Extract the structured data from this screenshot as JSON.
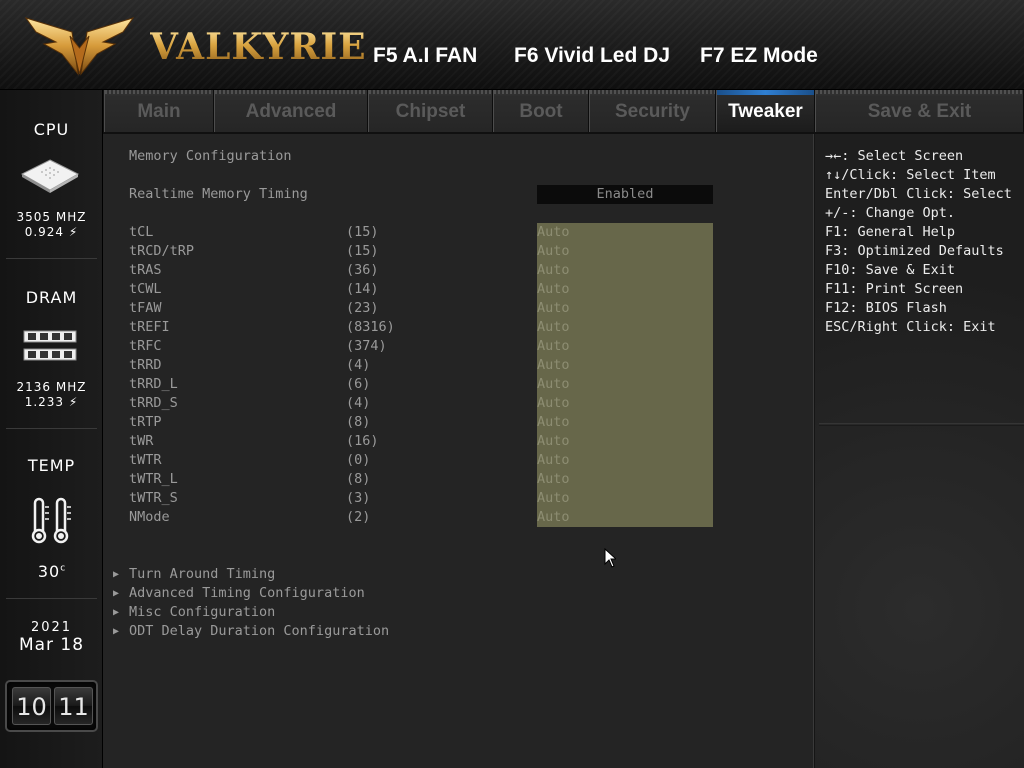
{
  "header": {
    "brand": "VALKYRIE",
    "hotkeys": [
      {
        "label": "F5 A.I FAN"
      },
      {
        "label": "F6 Vivid Led DJ"
      },
      {
        "label": "F7 EZ Mode"
      }
    ]
  },
  "sidebar": {
    "cpu": {
      "title": "CPU",
      "freq": "3505 MHZ",
      "volt": "0.924",
      "icon": "cpu-chip-icon"
    },
    "dram": {
      "title": "DRAM",
      "freq": "2136 MHZ",
      "volt": "1.233",
      "icon": "ram-module-icon"
    },
    "temp": {
      "title": "TEMP",
      "value": "30",
      "unit": "c",
      "icon": "thermometer-icon"
    },
    "date": {
      "year": "2021",
      "month_day": "Mar 18"
    },
    "clock": {
      "hour": "10",
      "minute": "11"
    }
  },
  "tabs": [
    {
      "label": "Main"
    },
    {
      "label": "Advanced"
    },
    {
      "label": "Chipset"
    },
    {
      "label": "Boot"
    },
    {
      "label": "Security"
    },
    {
      "label": "Tweaker",
      "active": true
    },
    {
      "label": "Save & Exit"
    }
  ],
  "main": {
    "section_title": "Memory Configuration",
    "realtime": {
      "label": "Realtime Memory Timing",
      "value": "Enabled"
    },
    "timings": [
      {
        "label": "tCL",
        "current": "(15)",
        "value": "Auto"
      },
      {
        "label": "tRCD/tRP",
        "current": "(15)",
        "value": "Auto"
      },
      {
        "label": "tRAS",
        "current": "(36)",
        "value": "Auto"
      },
      {
        "label": "tCWL",
        "current": "(14)",
        "value": "Auto"
      },
      {
        "label": "tFAW",
        "current": "(23)",
        "value": "Auto"
      },
      {
        "label": "tREFI",
        "current": "(8316)",
        "value": "Auto"
      },
      {
        "label": "tRFC",
        "current": "(374)",
        "value": "Auto"
      },
      {
        "label": "tRRD",
        "current": "(4)",
        "value": "Auto"
      },
      {
        "label": "tRRD_L",
        "current": "(6)",
        "value": "Auto"
      },
      {
        "label": "tRRD_S",
        "current": "(4)",
        "value": "Auto"
      },
      {
        "label": "tRTP",
        "current": "(8)",
        "value": "Auto"
      },
      {
        "label": "tWR",
        "current": "(16)",
        "value": "Auto"
      },
      {
        "label": "tWTR",
        "current": "(0)",
        "value": "Auto"
      },
      {
        "label": "tWTR_L",
        "current": "(8)",
        "value": "Auto"
      },
      {
        "label": "tWTR_S",
        "current": "(3)",
        "value": "Auto"
      },
      {
        "label": "NMode",
        "current": "(2)",
        "value": "Auto"
      }
    ],
    "submenus": [
      {
        "label": "Turn Around Timing"
      },
      {
        "label": "Advanced Timing Configuration"
      },
      {
        "label": "Misc Configuration"
      },
      {
        "label": "ODT Delay Duration Configuration"
      }
    ]
  },
  "help": {
    "lines": [
      "→←: Select Screen",
      "↑↓/Click: Select Item",
      "Enter/Dbl Click: Select",
      "+/-: Change Opt.",
      "F1: General Help",
      "F3: Optimized Defaults",
      "F10: Save & Exit",
      "F11: Print Screen",
      "F12: BIOS Flash",
      "ESC/Right Click: Exit"
    ]
  },
  "colors": {
    "accent": "#2f7fd2",
    "option_fill": "#67674a",
    "brand_gold": "#d9a441"
  }
}
